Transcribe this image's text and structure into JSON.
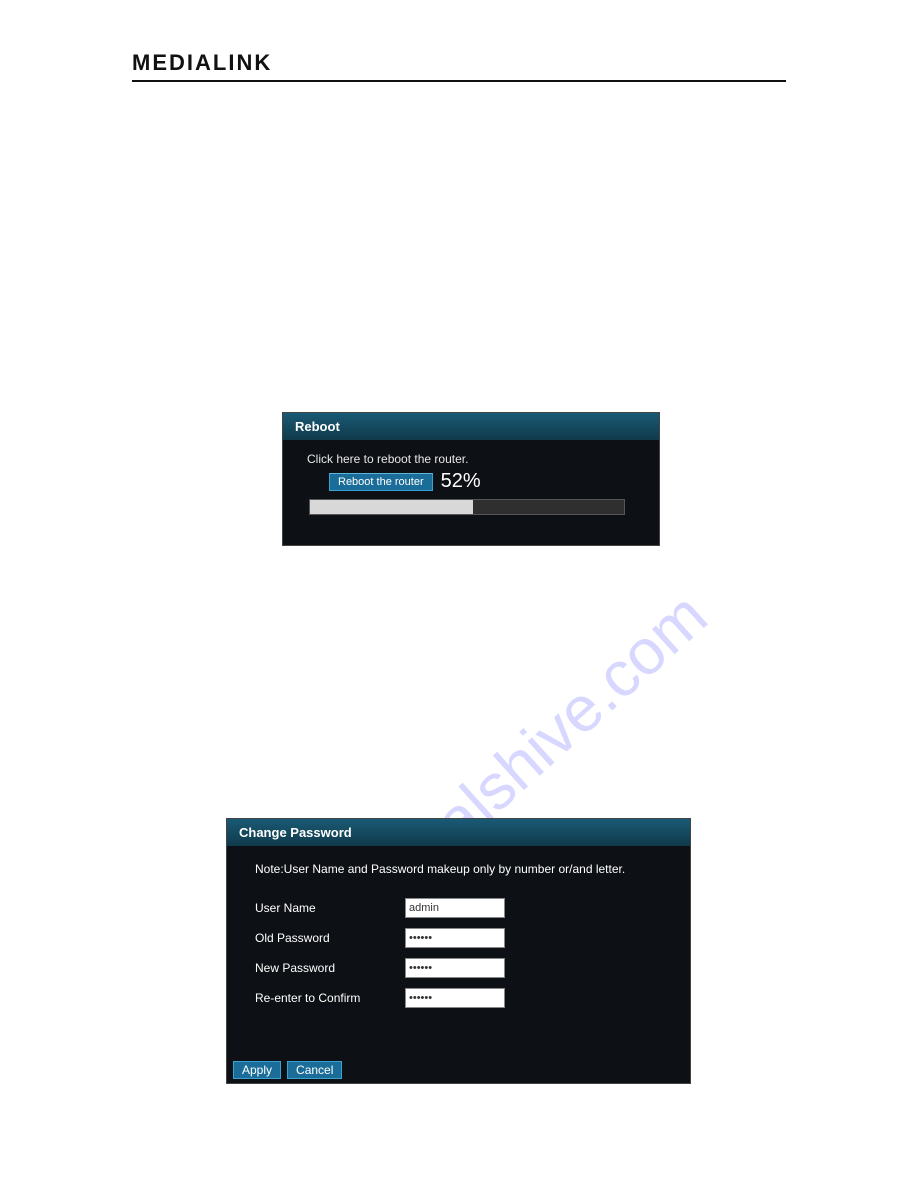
{
  "brand": "MEDIALINK",
  "reboot": {
    "title": "Reboot",
    "instruction": "Click here to reboot the router.",
    "button_label": "Reboot the router",
    "percent_text": "52%",
    "percent_value": 52
  },
  "change_password": {
    "title": "Change Password",
    "note": "Note:User Name and Password makeup only by number or/and letter.",
    "labels": {
      "username": "User Name",
      "old_password": "Old Password",
      "new_password": "New Password",
      "confirm": "Re-enter to Confirm"
    },
    "values": {
      "username": "admin",
      "old_password": "••••••",
      "new_password": "••••••",
      "confirm": "••••••"
    },
    "buttons": {
      "apply": "Apply",
      "cancel": "Cancel"
    }
  },
  "watermark": "manualshive.com"
}
